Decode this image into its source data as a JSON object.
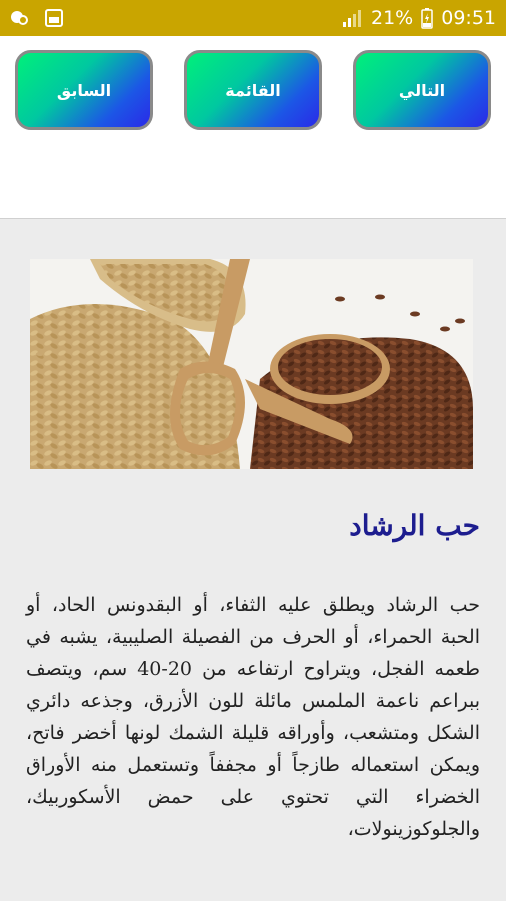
{
  "status_bar": {
    "battery": "21%",
    "time": "09:51",
    "icons": [
      "message-bubble-icon",
      "image-icon",
      "signal-icon",
      "battery-charging-icon"
    ]
  },
  "nav": {
    "next_label": "التالي",
    "list_label": "القائمة",
    "prev_label": "السابق"
  },
  "article": {
    "image_alt": "wheat seeds and flax seeds in wooden spoons",
    "title": "حب الرشاد",
    "body": "حب الرشاد ويطلق عليه الثفاء، أو البقدونس الحاد، أو الحبة الحمراء، أو الحرف من الفصيلة الصليبية، يشبه في طعمه الفجل، ويتراوح ارتفاعه من 20-40 سم، ويتصف ببراعم ناعمة الملمس مائلة للون الأزرق، وجذعه دائري الشكل ومتشعب، وأوراقه قليلة الشمك لونها أخضر فاتح، ويمكن استعماله طازجاً أو مجففاً وتستعمل منه الأوراق الخضراء التي تحتوي على حمض الأسكوربيك، والجلوكوزينولات،"
  },
  "colors": {
    "status_bar": "#c9a500",
    "title": "#1d1d8f",
    "content_bg": "#ececec"
  }
}
